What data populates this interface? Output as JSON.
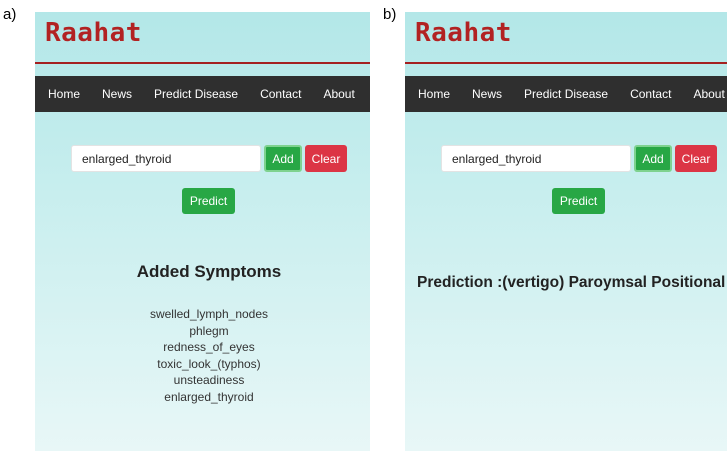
{
  "panels": {
    "a": {
      "label": "a)",
      "logo": "Raahat",
      "nav": [
        "Home",
        "News",
        "Predict Disease",
        "Contact",
        "About"
      ],
      "search": {
        "value": "enlarged_thyroid",
        "placeholder": ""
      },
      "buttons": {
        "add": "Add",
        "clear": "Clear",
        "predict": "Predict"
      },
      "symptoms_title": "Added Symptoms",
      "symptoms": [
        "swelled_lymph_nodes",
        "phlegm",
        "redness_of_eyes",
        "toxic_look_(typhos)",
        "unsteadiness",
        "enlarged_thyroid"
      ]
    },
    "b": {
      "label": "b)",
      "logo": "Raahat",
      "nav": [
        "Home",
        "News",
        "Predict Disease",
        "Contact",
        "About"
      ],
      "search": {
        "value": "enlarged_thyroid",
        "placeholder": ""
      },
      "buttons": {
        "add": "Add",
        "clear": "Clear",
        "predict": "Predict"
      },
      "prediction": "Prediction :(vertigo) Paroymsal Positional Vertigo"
    }
  },
  "colors": {
    "logo": "#b22222",
    "navbar": "#2f2f2f",
    "add_button": "#28a745",
    "clear_button": "#dc3545",
    "background": "#b3e7e8"
  }
}
